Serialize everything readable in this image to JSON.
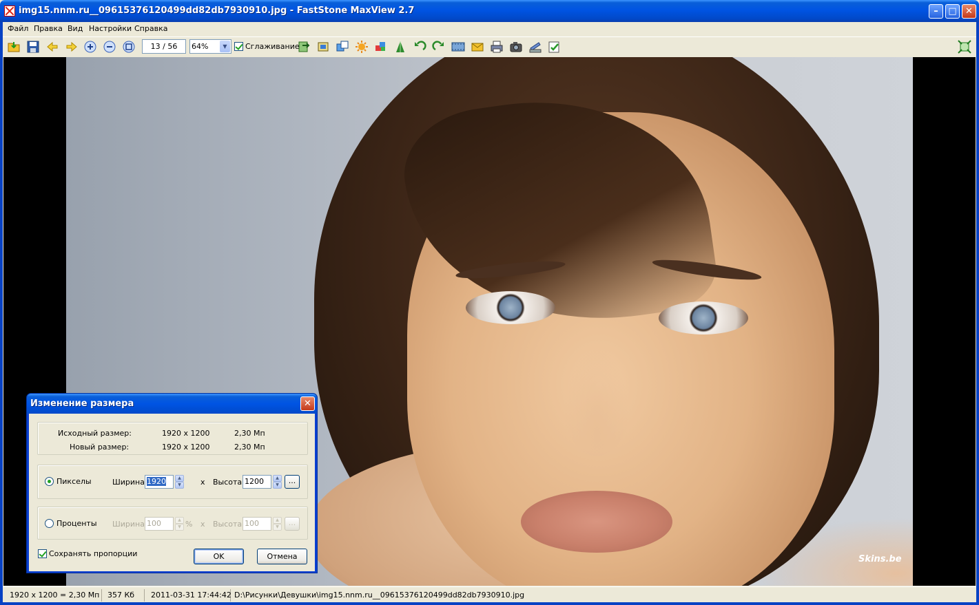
{
  "window": {
    "title": "img15.nnm.ru__09615376120499dd82db7930910.jpg - FastStone MaxView 2.7",
    "min_glyph": "–",
    "max_glyph": "□",
    "close_glyph": "✕"
  },
  "menu": [
    "Файл",
    "Правка",
    "Вид",
    "Настройки",
    "Справка"
  ],
  "toolbar": {
    "icons": [
      "open-icon",
      "save-icon",
      "prev-icon",
      "next-icon",
      "zoom-in-icon",
      "zoom-out-icon",
      "actual-size-icon",
      "copy-to-icon",
      "crop-icon",
      "resize-icon",
      "adjust-icon",
      "colors-icon",
      "sharpen-icon",
      "rotate-left-icon",
      "rotate-right-icon",
      "slideshow-icon",
      "email-icon",
      "print-icon",
      "screenshot-icon",
      "scan-icon",
      "settings-icon",
      "fullscreen-icon"
    ],
    "counter": "13 / 56",
    "zoom": "64%",
    "smoothing_label": "Сглаживание",
    "smoothing_checked": true
  },
  "image": {
    "watermark": "Skins.be"
  },
  "dialog": {
    "title": "Изменение размера",
    "close_glyph": "✕",
    "original_label": "Исходный размер:",
    "original_dims": "1920 x 1200",
    "original_mp": "2,30 Мп",
    "new_label": "Новый размер:",
    "new_dims": "1920 x 1200",
    "new_mp": "2,30 Мп",
    "pixels": {
      "label": "Пикселы",
      "selected": true,
      "width_label": "Ширина:",
      "width_value": "1920",
      "x": "x",
      "height_label": "Высота:",
      "height_value": "1200",
      "dots": "..."
    },
    "percent": {
      "label": "Проценты",
      "selected": false,
      "width_label": "Ширина:",
      "width_value": "100",
      "pct": "%",
      "x": "x",
      "height_label": "Высота:",
      "height_value": "100",
      "dots": "..."
    },
    "keep_ratio_label": "Сохранять пропорции",
    "keep_ratio_checked": true,
    "ok_label": "OK",
    "cancel_label": "Отмена"
  },
  "status": {
    "resolution": "1920 x 1200 = 2,30 Мп",
    "size": "357 Кб",
    "date": "2011-03-31 17:44:42",
    "path": "D:\\Рисунки\\Девушки\\img15.nnm.ru__09615376120499dd82db7930910.jpg"
  }
}
